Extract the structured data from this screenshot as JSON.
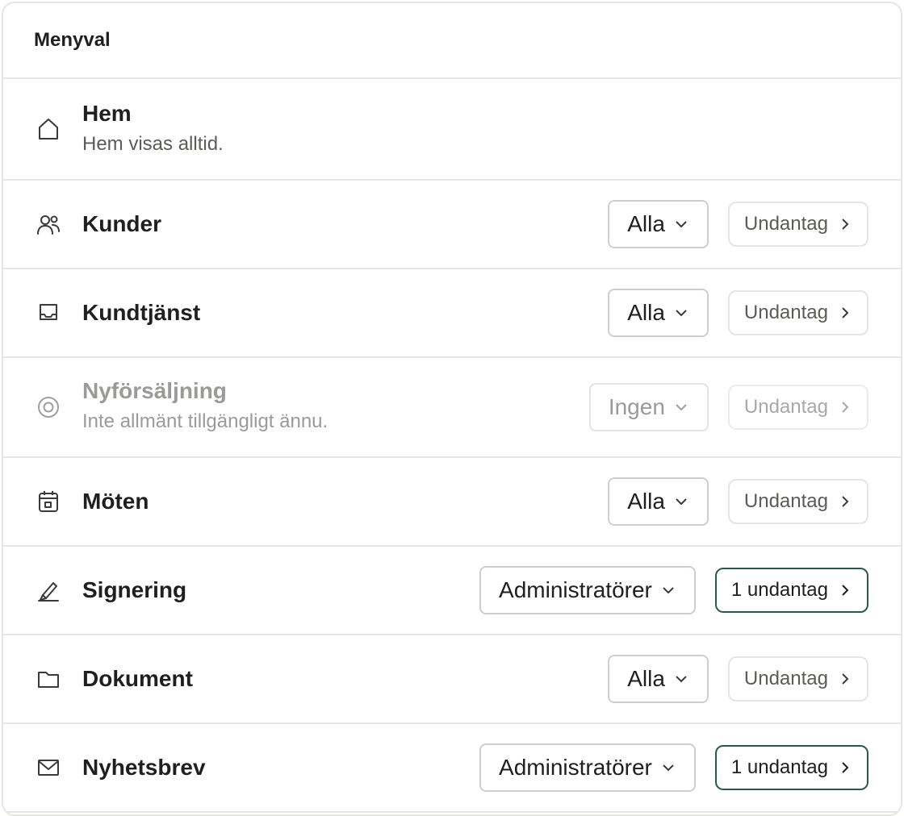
{
  "header": {
    "title": "Menyval"
  },
  "rows": [
    {
      "title": "Hem",
      "desc": "Hem visas alltid.",
      "icon": "home-icon"
    },
    {
      "title": "Kunder",
      "icon": "users-icon",
      "select": "Alla",
      "exceptions": "Undantag"
    },
    {
      "title": "Kundtjänst",
      "icon": "inbox-icon",
      "select": "Alla",
      "exceptions": "Undantag"
    },
    {
      "title": "Nyförsäljning",
      "desc": "Inte allmänt tillgängligt ännu.",
      "icon": "target-icon",
      "select": "Ingen",
      "exceptions": "Undantag",
      "disabled": true
    },
    {
      "title": "Möten",
      "icon": "calendar-icon",
      "select": "Alla",
      "exceptions": "Undantag"
    },
    {
      "title": "Signering",
      "icon": "signature-icon",
      "select": "Administratörer",
      "exceptions": "1 undantag",
      "exceptions_active": true
    },
    {
      "title": "Dokument",
      "icon": "folder-icon",
      "select": "Alla",
      "exceptions": "Undantag"
    },
    {
      "title": "Nyhetsbrev",
      "icon": "mail-icon",
      "select": "Administratörer",
      "exceptions": "1 undantag",
      "exceptions_active": true
    }
  ],
  "colors": {
    "accent_border": "#2a5b46",
    "divider": "#e6e6e3",
    "muted_text": "#5b5b58",
    "disabled_text": "#9a9a98"
  }
}
